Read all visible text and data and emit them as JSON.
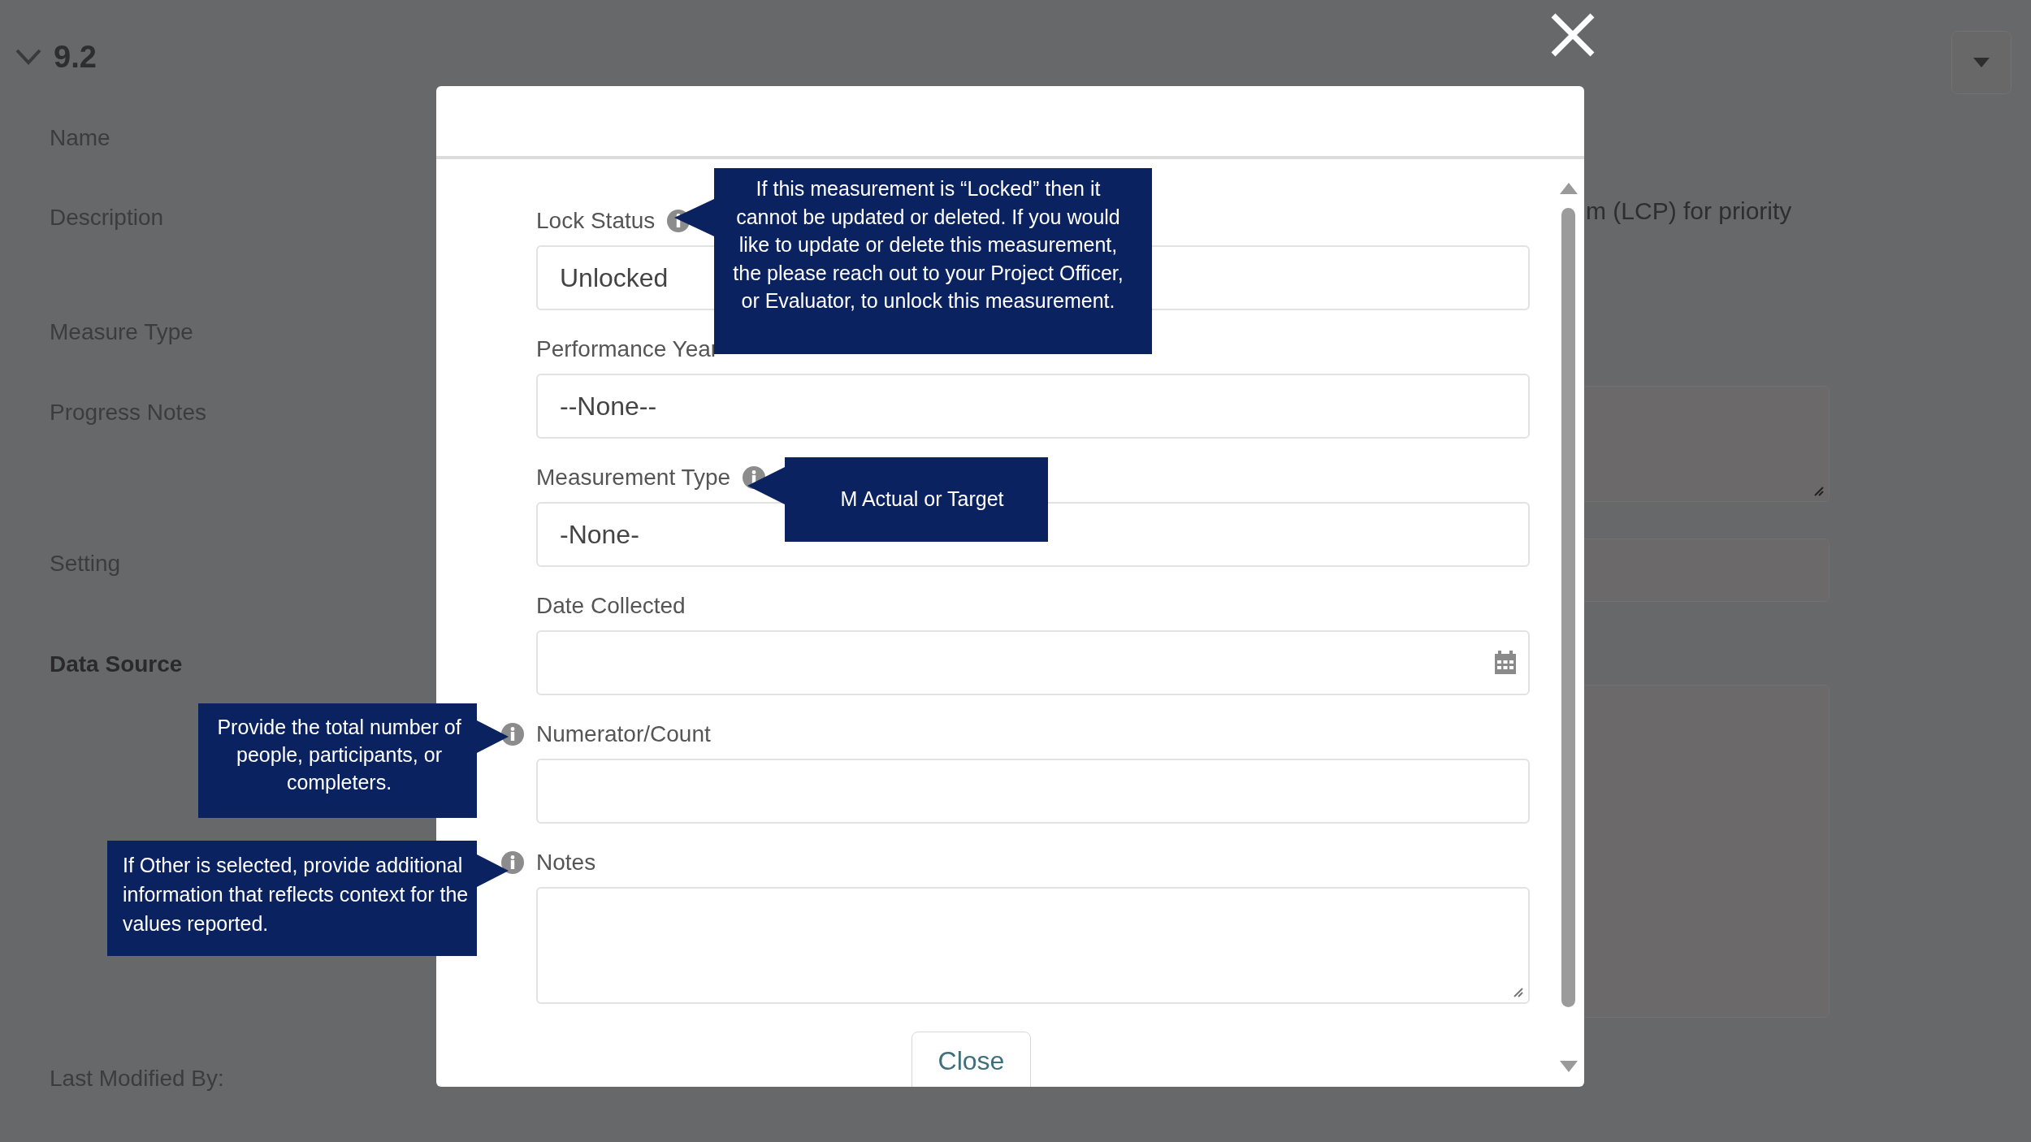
{
  "background": {
    "section_title": "9.2",
    "labels": [
      {
        "text": "Name",
        "bold": false
      },
      {
        "text": "Description",
        "bold": false
      },
      {
        "text": "Measure Type",
        "bold": false
      },
      {
        "text": "Progress Notes",
        "bold": false
      },
      {
        "text": "Setting",
        "bold": false
      },
      {
        "text": "Data Source",
        "bold": true
      }
    ],
    "description_text": "m (LCP) for priority",
    "footer_label": "Last Modified By:"
  },
  "modal": {
    "fields": [
      {
        "label": "Lock Status",
        "kind": "select",
        "value": "Unlocked",
        "info": true,
        "info_before_label": false,
        "tooltip": "If this measurement is “Locked” then it cannot be updated or deleted. If you would like to update or  delete this measurement, the please reach out to your Project Officer, or Evaluator, to unlock this measurement."
      },
      {
        "label": "Performance Year",
        "kind": "select",
        "value": "--None--",
        "info": false
      },
      {
        "label": "Measurement Type",
        "kind": "select",
        "value": "-None-",
        "info": true,
        "info_before_label": false,
        "tooltip": "M Actual or Target"
      },
      {
        "label": "Date Collected",
        "kind": "date",
        "info": false
      },
      {
        "label": "Numerator/Count",
        "kind": "text",
        "info": true,
        "info_before_label": true,
        "tooltip": "Provide the total number of people, participants, or completers."
      },
      {
        "label": "Notes",
        "kind": "textarea",
        "info": true,
        "info_before_label": true,
        "tooltip": "If Other is selected, provide additional information that reflects context for the values reported."
      }
    ],
    "close_button": "Close"
  }
}
